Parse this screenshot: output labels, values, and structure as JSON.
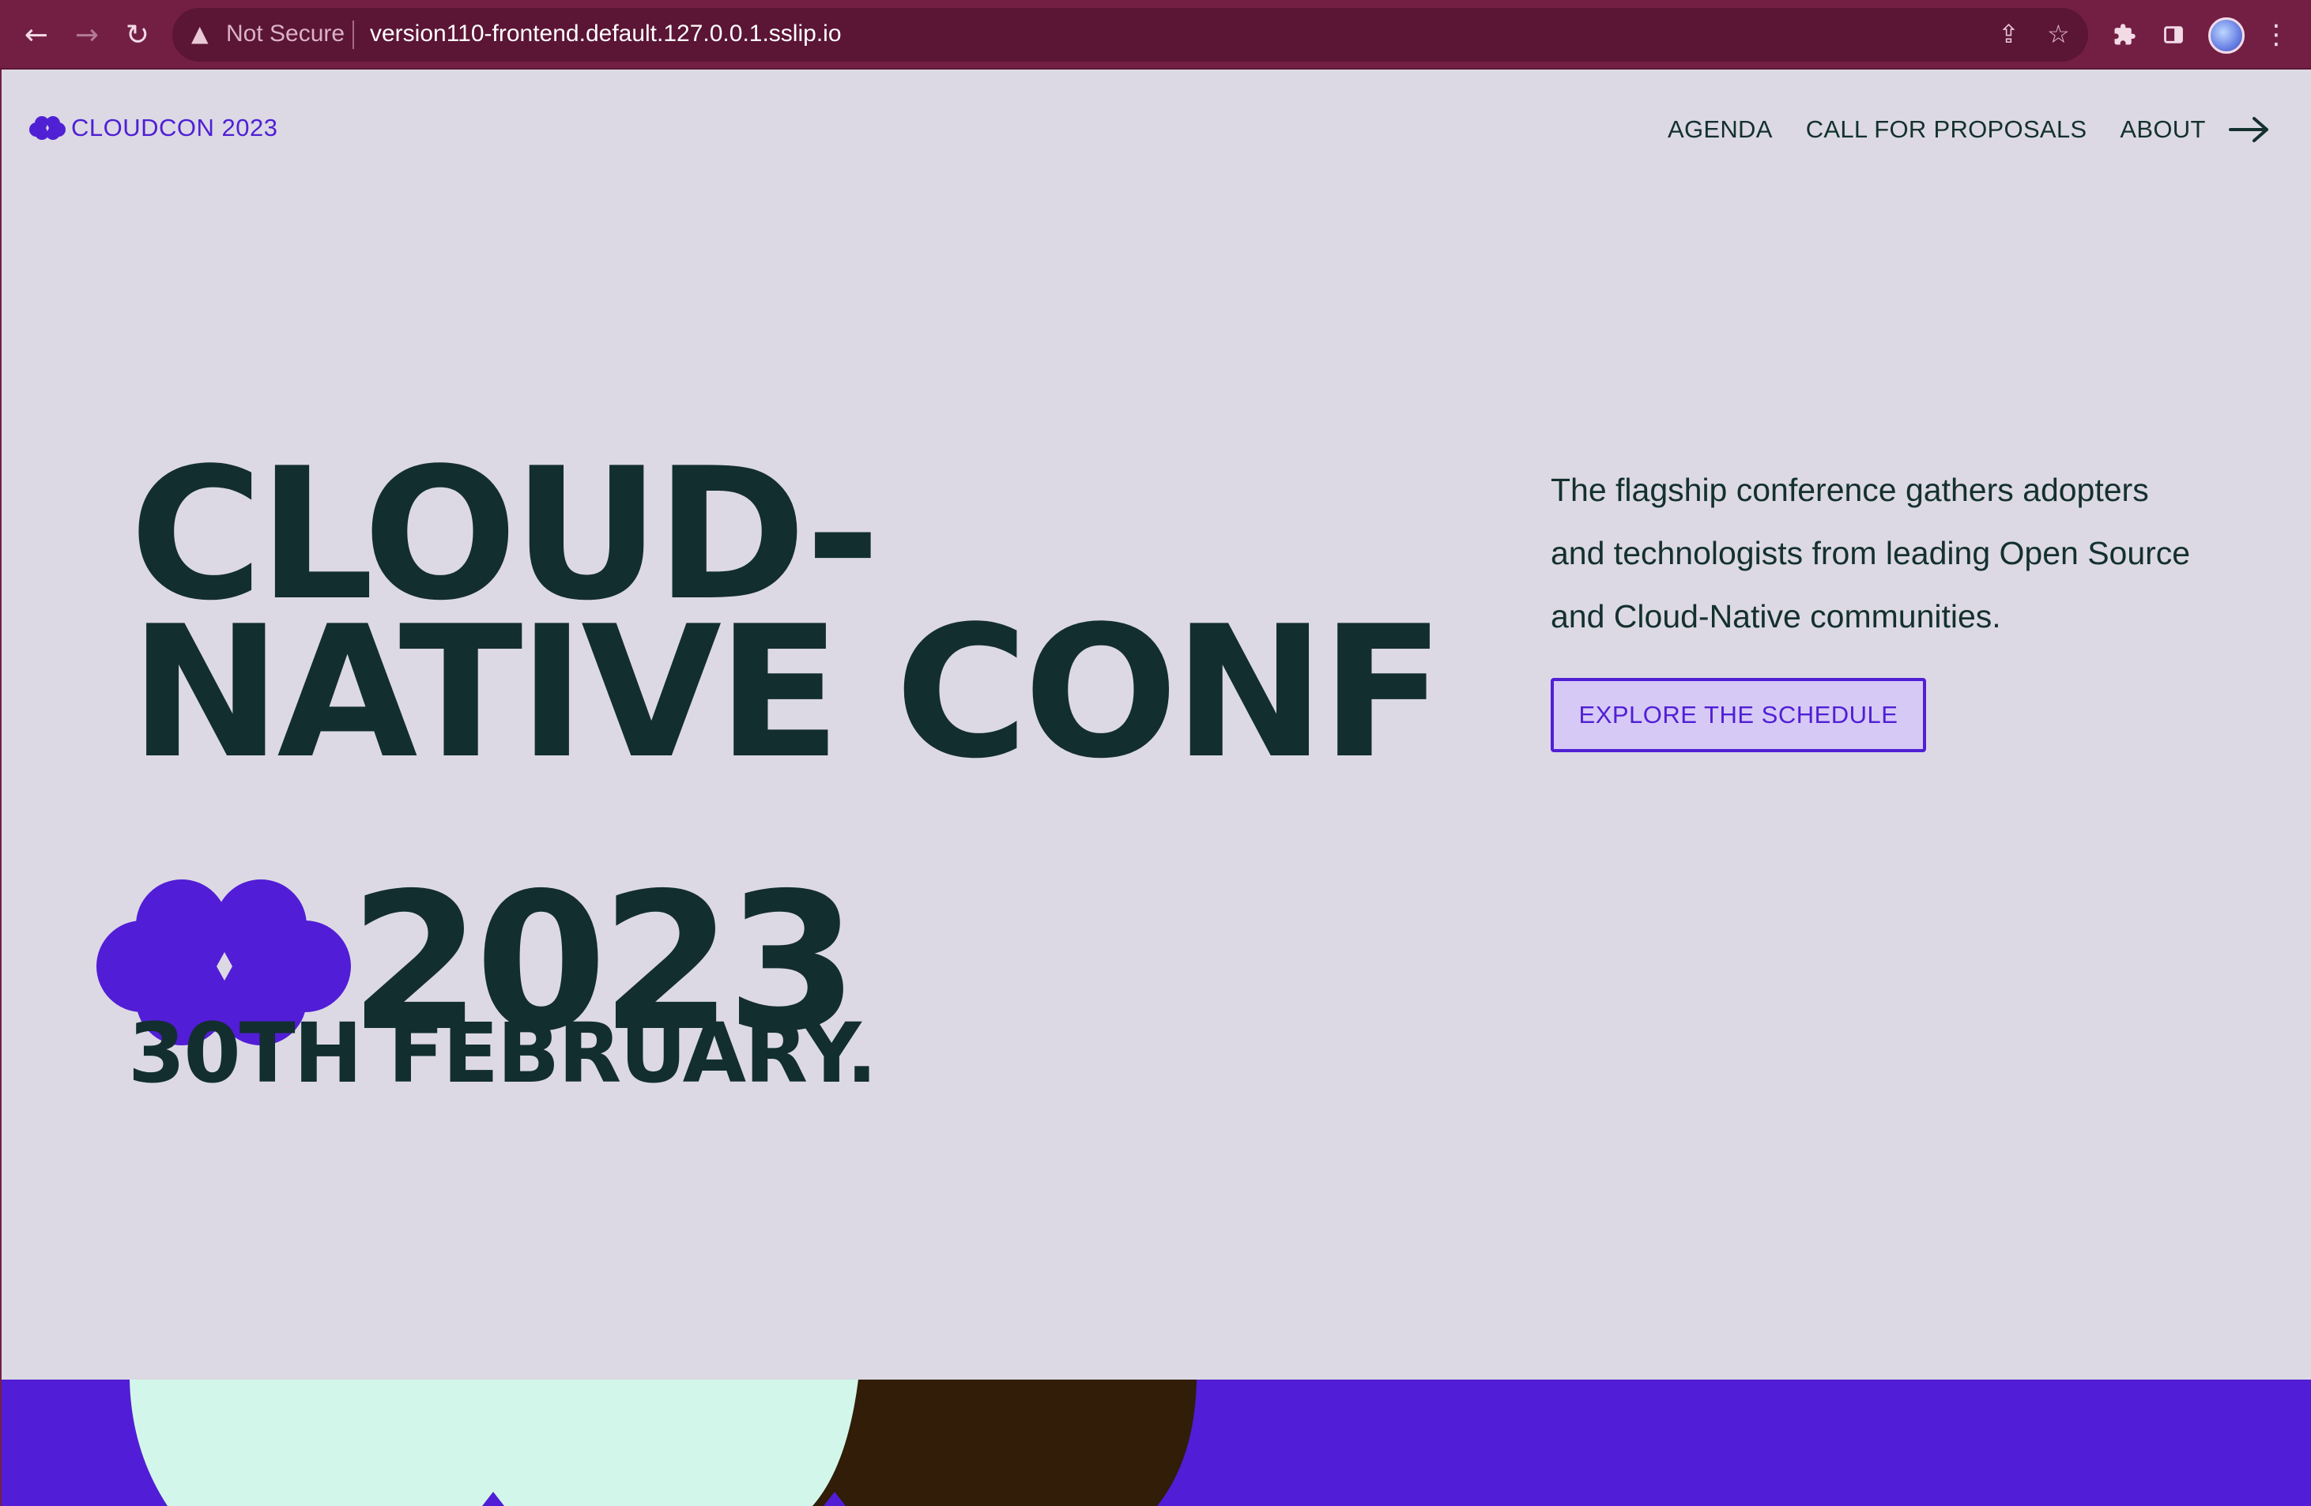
{
  "browser": {
    "not_secure_label": "Not Secure",
    "url": "version110-frontend.default.127.0.0.1.sslip.io",
    "icons": {
      "back": "back-arrow-icon",
      "forward": "forward-arrow-icon",
      "reload": "reload-icon",
      "warning": "warning-icon",
      "share": "share-icon",
      "bookmark": "star-icon",
      "extensions": "puzzle-icon",
      "side_panel": "side-panel-icon",
      "menu": "kebab-menu-icon"
    }
  },
  "header": {
    "brand": "CLOUDCON 2023",
    "nav": [
      "AGENDA",
      "CALL FOR PROPOSALS",
      "ABOUT"
    ],
    "arrow_icon": "arrow-right-icon"
  },
  "hero": {
    "title_line1": "CLOUD-",
    "title_line2": "NATIVE CONF",
    "year": "2023",
    "date": "30TH FEBRUARY.",
    "description": "The flagship conference gathers adopters and technologists from leading Open Source and Cloud-Native communities.",
    "cta": "EXPLORE THE SCHEDULE"
  },
  "colors": {
    "browser_chrome": "#731f44",
    "page_background": "#dcd9e4",
    "brand_purple": "#5020d4",
    "text_dark": "#132e2f",
    "cta_background": "#d7c9f6",
    "band_purple": "#521dd6",
    "band_mint": "#d2f7ea",
    "band_brown": "#311d08"
  }
}
